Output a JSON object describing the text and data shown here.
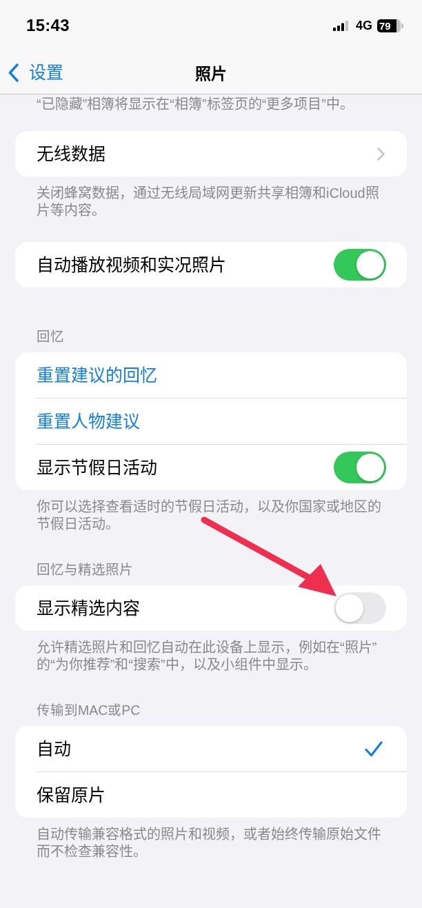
{
  "status_bar": {
    "time": "15:43",
    "network": "4G",
    "battery": "79"
  },
  "nav": {
    "back": "设置",
    "title": "照片"
  },
  "top_note": "“已隐藏”相簿将显示在“相簿”标签页的“更多项目”中。",
  "sections": [
    {
      "rows": [
        {
          "kind": "link",
          "label": "无线数据"
        }
      ],
      "footer": "关闭蜂窝数据，通过无线局域网更新共享相簿和iCloud照片等内容。"
    },
    {
      "rows": [
        {
          "kind": "toggle",
          "label": "自动播放视频和实况照片",
          "on": true
        }
      ]
    },
    {
      "header": "回忆",
      "rows": [
        {
          "kind": "action",
          "label": "重置建议的回忆"
        },
        {
          "kind": "action",
          "label": "重置人物建议"
        },
        {
          "kind": "toggle",
          "label": "显示节假日活动",
          "on": true
        }
      ],
      "footer": "你可以选择查看适时的节假日活动，以及你国家或地区的节假日活动。"
    },
    {
      "header": "回忆与精选照片",
      "rows": [
        {
          "kind": "toggle",
          "label": "显示精选内容",
          "on": false
        }
      ],
      "footer": "允许精选照片和回忆自动在此设备上显示，例如在“照片”的“为你推荐”和“搜索”中，以及小组件中显示。"
    },
    {
      "header": "传输到MAC或PC",
      "rows": [
        {
          "kind": "option",
          "label": "自动",
          "selected": true
        },
        {
          "kind": "option",
          "label": "保留原片",
          "selected": false
        }
      ],
      "footer": "自动传输兼容格式的照片和视频，或者始终传输原始文件而不检查兼容性。"
    }
  ]
}
